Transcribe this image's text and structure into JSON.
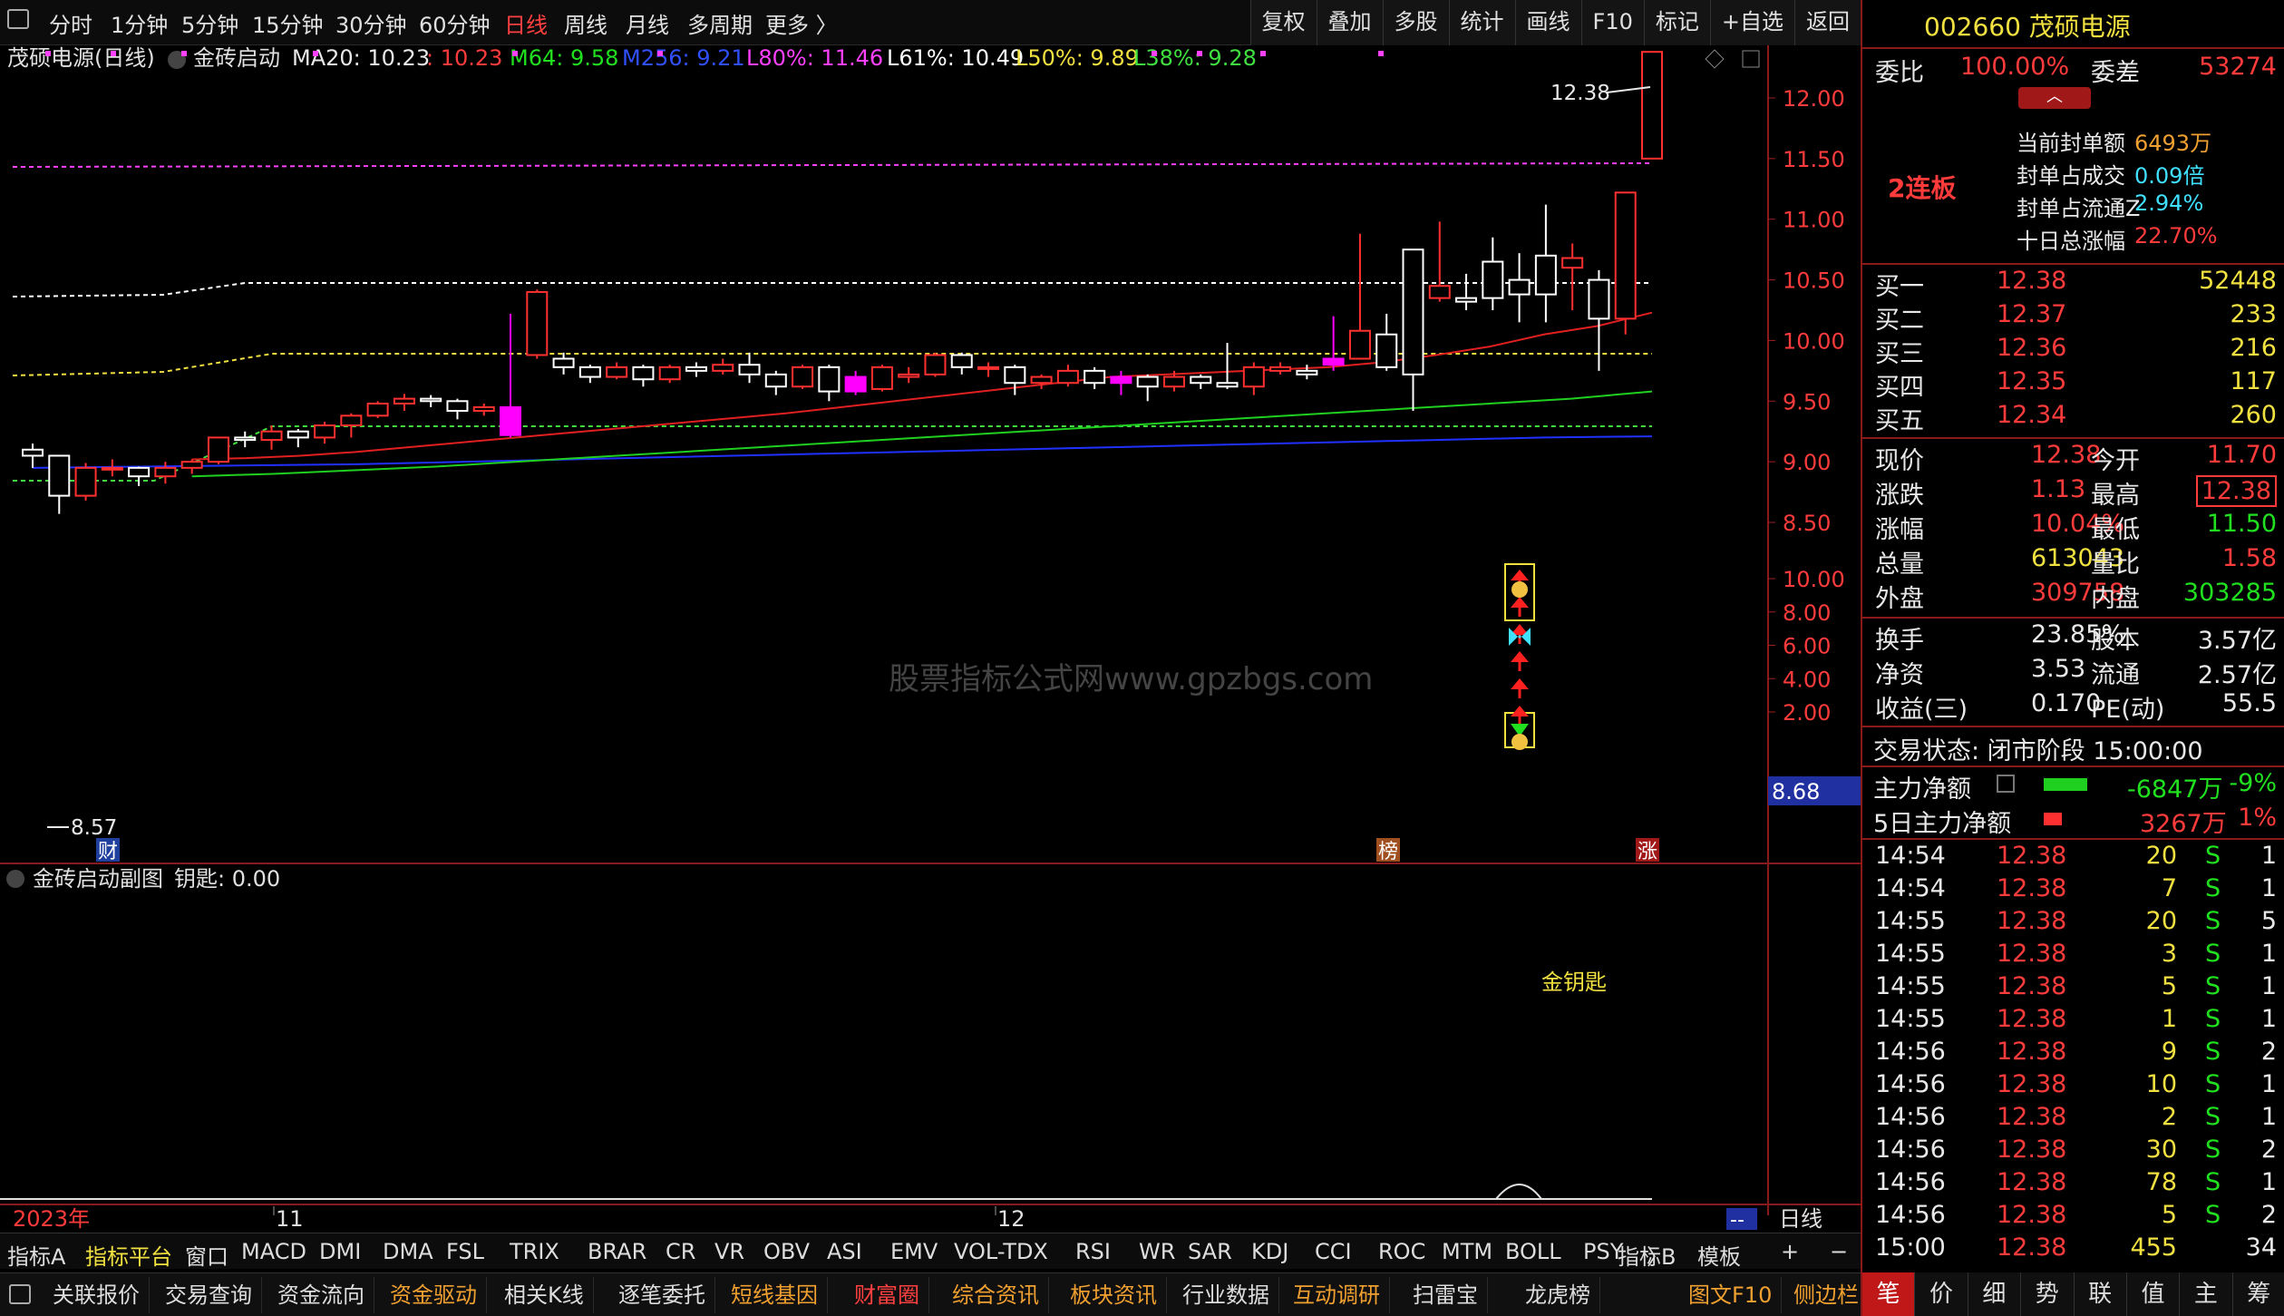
{
  "toolbar": {
    "periods": [
      "分时",
      "1分钟",
      "5分钟",
      "15分钟",
      "30分钟",
      "60分钟",
      "日线",
      "周线",
      "月线",
      "多周期",
      "更多 〉"
    ],
    "active_period": "日线",
    "tools": [
      "复权",
      "叠加",
      "多股",
      "统计",
      "画线",
      "F10",
      "标记",
      "+自选",
      "返回"
    ]
  },
  "chart_header": {
    "title": "茂硕电源(日线)",
    "indicator": "金砖启动",
    "ma20": "MA20: 10.23",
    "val": ": 10.23",
    "m64": "M64: 9.58",
    "m256": "M256: 9.21",
    "l80": "L80%: 11.46",
    "l61": "L61%: 10.49",
    "l50": "L50%: 9.89",
    "l38": "L38%: 9.28"
  },
  "annotations": {
    "high": "12.38",
    "low": "8.57",
    "current_axis": "8.68",
    "cai": "财",
    "bang": "榜",
    "zhang": "涨",
    "sub_label": "金钥匙",
    "year": "2023年",
    "m11": "11",
    "m12": "12",
    "dash": "--",
    "period_label": "日线"
  },
  "colors": {
    "up": "#ff4040",
    "down": "#ffffff",
    "magenta": "#ff00ff",
    "ma_red": "#e02020",
    "ma_green": "#20d020",
    "ma_blue": "#2030ff"
  },
  "chart_data": {
    "type": "candlestick",
    "y_axis_main": [
      "12.00",
      "11.50",
      "11.00",
      "10.50",
      "10.00",
      "9.50",
      "9.00",
      "8.50"
    ],
    "y_axis_sub": [
      "10.00",
      "8.00",
      "6.00",
      "4.00",
      "2.00"
    ],
    "candles": [
      [
        9.1,
        9.05,
        9.15,
        8.95
      ],
      [
        9.05,
        8.72,
        9.05,
        8.57
      ],
      [
        8.72,
        8.95,
        8.99,
        8.68
      ],
      [
        8.95,
        8.95,
        9.02,
        8.88
      ],
      [
        8.95,
        8.88,
        8.96,
        8.8
      ],
      [
        8.88,
        8.95,
        9.0,
        8.82
      ],
      [
        8.95,
        9.0,
        9.02,
        8.9
      ],
      [
        9.0,
        9.2,
        9.2,
        8.98
      ],
      [
        9.2,
        9.18,
        9.25,
        9.12
      ],
      [
        9.18,
        9.25,
        9.3,
        9.1
      ],
      [
        9.25,
        9.2,
        9.27,
        9.12
      ],
      [
        9.2,
        9.3,
        9.33,
        9.15
      ],
      [
        9.3,
        9.38,
        9.4,
        9.2
      ],
      [
        9.38,
        9.48,
        9.5,
        9.36
      ],
      [
        9.48,
        9.52,
        9.56,
        9.42
      ],
      [
        9.52,
        9.5,
        9.55,
        9.45
      ],
      [
        9.5,
        9.42,
        9.52,
        9.35
      ],
      [
        9.42,
        9.45,
        9.48,
        9.38
      ],
      [
        9.45,
        9.22,
        10.22,
        9.2
      ],
      [
        9.88,
        10.4,
        10.42,
        9.85
      ],
      [
        9.85,
        9.78,
        9.9,
        9.72
      ],
      [
        9.78,
        9.7,
        9.8,
        9.65
      ],
      [
        9.7,
        9.78,
        9.82,
        9.68
      ],
      [
        9.78,
        9.68,
        9.8,
        9.62
      ],
      [
        9.68,
        9.78,
        9.8,
        9.65
      ],
      [
        9.78,
        9.75,
        9.82,
        9.7
      ],
      [
        9.75,
        9.8,
        9.85,
        9.72
      ],
      [
        9.8,
        9.72,
        9.9,
        9.65
      ],
      [
        9.72,
        9.62,
        9.75,
        9.55
      ],
      [
        9.62,
        9.78,
        9.8,
        9.6
      ],
      [
        9.78,
        9.58,
        9.8,
        9.5
      ],
      [
        9.58,
        9.7,
        9.75,
        9.55
      ],
      [
        9.6,
        9.78,
        9.8,
        9.58
      ],
      [
        9.7,
        9.72,
        9.78,
        9.65
      ],
      [
        9.72,
        9.88,
        9.9,
        9.7
      ],
      [
        9.88,
        9.78,
        9.9,
        9.72
      ],
      [
        9.78,
        9.78,
        9.82,
        9.7
      ],
      [
        9.78,
        9.65,
        9.8,
        9.55
      ],
      [
        9.65,
        9.7,
        9.72,
        9.6
      ],
      [
        9.65,
        9.75,
        9.8,
        9.62
      ],
      [
        9.75,
        9.65,
        9.78,
        9.6
      ],
      [
        9.65,
        9.7,
        9.75,
        9.55
      ],
      [
        9.7,
        9.62,
        9.72,
        9.5
      ],
      [
        9.62,
        9.7,
        9.75,
        9.58
      ],
      [
        9.7,
        9.65,
        9.72,
        9.6
      ],
      [
        9.65,
        9.62,
        9.98,
        9.6
      ],
      [
        9.62,
        9.78,
        9.82,
        9.55
      ],
      [
        9.75,
        9.78,
        9.82,
        9.72
      ],
      [
        9.75,
        9.72,
        9.8,
        9.68
      ],
      [
        9.8,
        9.85,
        10.2,
        9.75
      ],
      [
        9.85,
        10.08,
        10.88,
        9.85
      ],
      [
        10.05,
        9.78,
        10.22,
        9.75
      ],
      [
        10.75,
        9.72,
        10.75,
        9.42
      ],
      [
        10.35,
        10.45,
        10.98,
        10.32
      ],
      [
        10.35,
        10.32,
        10.55,
        10.25
      ],
      [
        10.65,
        10.35,
        10.85,
        10.25
      ],
      [
        10.5,
        10.38,
        10.72,
        10.15
      ],
      [
        10.7,
        10.38,
        11.12,
        10.15
      ],
      [
        10.6,
        10.68,
        10.8,
        10.25
      ],
      [
        10.5,
        10.18,
        10.58,
        9.75
      ],
      [
        10.18,
        11.22,
        11.22,
        10.05
      ],
      [
        11.5,
        12.38,
        12.38,
        11.5
      ]
    ],
    "ma20": [
      9.02,
      9.03,
      9.05,
      9.08,
      9.12,
      9.16,
      9.2,
      9.24,
      9.28,
      9.32,
      9.36,
      9.4,
      9.45,
      9.5,
      9.55,
      9.6,
      9.65,
      9.7,
      9.72,
      9.74,
      9.76,
      9.78,
      9.82,
      9.88,
      9.95,
      10.05,
      10.12,
      10.23
    ],
    "m64": [
      8.88,
      8.9,
      8.93,
      8.96,
      9.0,
      9.04,
      9.08,
      9.12,
      9.16,
      9.2,
      9.24,
      9.28,
      9.32,
      9.36,
      9.4,
      9.44,
      9.48,
      9.52,
      9.58
    ],
    "m256": [
      8.95,
      8.96,
      8.97,
      8.98,
      9.0,
      9.02,
      9.04,
      9.06,
      9.08,
      9.1,
      9.12,
      9.14,
      9.16,
      9.18,
      9.2,
      9.21
    ]
  },
  "quote": {
    "code_name": "002660 茂硕电源",
    "weibi_label": "委比",
    "weibi": "100.00%",
    "weicha_label": "委差",
    "weicha": "53274",
    "lianban": "2连板",
    "seal": [
      [
        "当前封单额",
        "6493万"
      ],
      [
        "封单占成交",
        "0.09倍"
      ],
      [
        "封单占流通Z",
        "2.94%"
      ],
      [
        "十日总涨幅",
        "22.70%"
      ]
    ],
    "bids": [
      [
        "买一",
        "12.38",
        "52448"
      ],
      [
        "买二",
        "12.37",
        "233"
      ],
      [
        "买三",
        "12.36",
        "216"
      ],
      [
        "买四",
        "12.35",
        "117"
      ],
      [
        "买五",
        "12.34",
        "260"
      ]
    ],
    "stats": [
      [
        "现价",
        "12.38",
        "今开",
        "11.70"
      ],
      [
        "涨跌",
        "1.13",
        "最高",
        "12.38"
      ],
      [
        "涨幅",
        "10.04%",
        "最低",
        "11.50"
      ],
      [
        "总量",
        "613043",
        "量比",
        "1.58"
      ],
      [
        "外盘",
        "309758",
        "内盘",
        "303285"
      ]
    ],
    "stats2": [
      [
        "换手",
        "23.85%",
        "股本",
        "3.57亿"
      ],
      [
        "净资",
        "3.53",
        "流通",
        "2.57亿"
      ],
      [
        "收益(三)",
        "0.170",
        "PE(动)",
        "55.5"
      ]
    ],
    "trade_state": "交易状态: 闭市阶段 15:00:00",
    "main_net_label": "主力净额",
    "main_net": "-6847万",
    "main_net_pct": "-9%",
    "main5_label": "5日主力净额",
    "main5": "3267万",
    "main5_pct": "1%",
    "ticks": [
      [
        "14:54",
        "12.38",
        "20",
        "S",
        "1"
      ],
      [
        "14:54",
        "12.38",
        "7",
        "S",
        "1"
      ],
      [
        "14:55",
        "12.38",
        "20",
        "S",
        "5"
      ],
      [
        "14:55",
        "12.38",
        "3",
        "S",
        "1"
      ],
      [
        "14:55",
        "12.38",
        "5",
        "S",
        "1"
      ],
      [
        "14:55",
        "12.38",
        "1",
        "S",
        "1"
      ],
      [
        "14:56",
        "12.38",
        "9",
        "S",
        "2"
      ],
      [
        "14:56",
        "12.38",
        "10",
        "S",
        "1"
      ],
      [
        "14:56",
        "12.38",
        "2",
        "S",
        "1"
      ],
      [
        "14:56",
        "12.38",
        "30",
        "S",
        "2"
      ],
      [
        "14:56",
        "12.38",
        "78",
        "S",
        "1"
      ],
      [
        "14:56",
        "12.38",
        "5",
        "S",
        "2"
      ],
      [
        "15:00",
        "12.38",
        "455",
        "",
        "34"
      ]
    ]
  },
  "subchart": {
    "title": "金砖启动副图",
    "value": "钥匙: 0.00"
  },
  "indicator_tabs": [
    "指标A",
    "指标平台",
    "窗口",
    "MACD",
    "DMI",
    "DMA",
    "FSL",
    "TRIX",
    "BRAR",
    "CR",
    "VR",
    "OBV",
    "ASI",
    "EMV",
    "VOL-TDX",
    "RSI",
    "WR",
    "SAR",
    "KDJ",
    "CCI",
    "ROC",
    "MTM",
    "BOLL",
    "PSY",
    "〉"
  ],
  "indicator_right": [
    "指标B",
    "模板",
    "+",
    "−"
  ],
  "bottom_buttons": [
    "关联报价",
    "交易查询",
    "资金流向",
    "资金驱动",
    "相关K线",
    "逐笔委托",
    "短线基因",
    "财富圈",
    "综合资讯",
    "板块资讯",
    "行业数据",
    "互动调研",
    "扫雷宝",
    "龙虎榜",
    "图文F10",
    "侧边栏"
  ],
  "right_tabs": [
    "笔",
    "价",
    "细",
    "势",
    "联",
    "值",
    "主",
    "筹"
  ],
  "watermark": "股票指标公式网www.gpzbgs.com"
}
